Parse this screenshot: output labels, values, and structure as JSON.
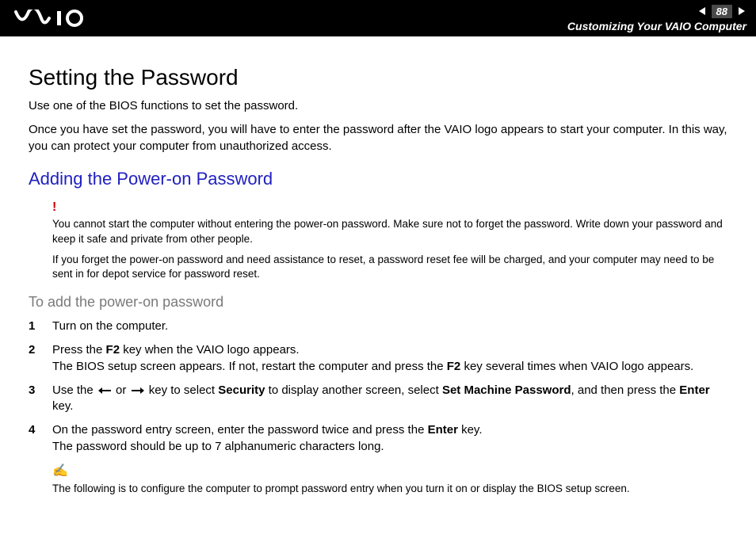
{
  "header": {
    "page_number": "88",
    "breadcrumb": "Customizing Your VAIO Computer"
  },
  "title": "Setting the Password",
  "intro": {
    "p1": "Use one of the BIOS functions to set the password.",
    "p2": "Once you have set the password, you will have to enter the password after the VAIO logo appears to start your computer. In this way, you can protect your computer from unauthorized access."
  },
  "section1": {
    "heading": "Adding the Power-on Password",
    "warning": {
      "p1": "You cannot start the computer without entering the power-on password. Make sure not to forget the password. Write down your password and keep it safe and private from other people.",
      "p2": "If you forget the power-on password and need assistance to reset, a password reset fee will be charged, and your computer may need to be sent in for depot service for password reset."
    },
    "subheading": "To add the power-on password",
    "steps": {
      "s1": "Turn on the computer.",
      "s2a": "Press the ",
      "s2b": "F2",
      "s2c": " key when the VAIO logo appears.",
      "s2d": "The BIOS setup screen appears. If not, restart the computer and press the ",
      "s2e": "F2",
      "s2f": " key several times when VAIO logo appears.",
      "s3a": "Use the ",
      "s3b": " or ",
      "s3c": " key to select ",
      "s3d": "Security",
      "s3e": " to display another screen, select ",
      "s3f": "Set Machine Password",
      "s3g": ", and then press the ",
      "s3h": "Enter",
      "s3i": " key.",
      "s4a": "On the password entry screen, enter the password twice and press the ",
      "s4b": "Enter",
      "s4c": " key.",
      "s4d": "The password should be up to 7 alphanumeric characters long."
    },
    "note": {
      "p1": "The following is to configure the computer to prompt password entry when you turn it on or display the BIOS setup screen."
    }
  }
}
